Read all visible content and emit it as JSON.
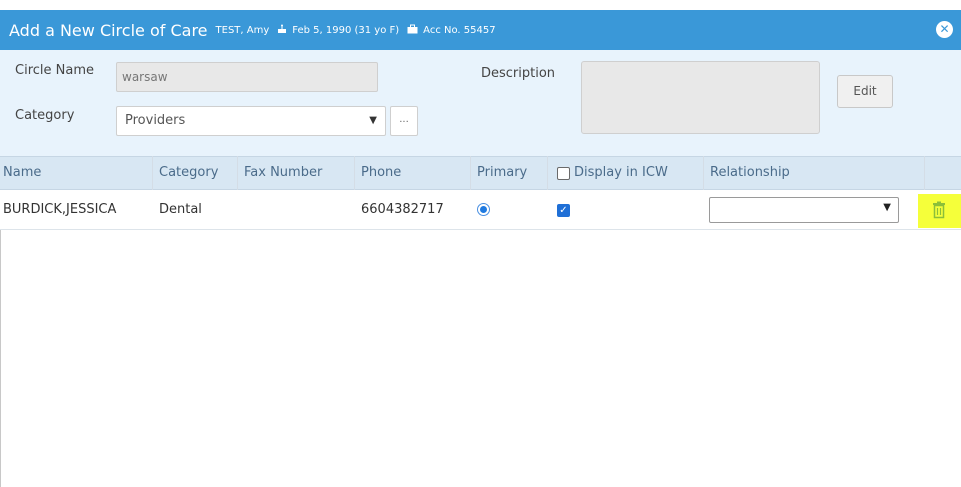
{
  "dialog": {
    "title": "Add a New Circle of Care",
    "patient_name": "TEST, Amy",
    "dob": "Feb 5, 1990 (31 yo F)",
    "account": "Acc No. 55457",
    "close_icon": "close-icon",
    "accent_color": "#3a98d8"
  },
  "form": {
    "circle_name_label": "Circle Name",
    "circle_name_value": "warsaw",
    "category_label": "Category",
    "category_value": "Providers",
    "more_button": "...",
    "description_label": "Description",
    "edit_button": "Edit"
  },
  "table": {
    "headers": {
      "name": "Name",
      "category": "Category",
      "fax": "Fax Number",
      "phone": "Phone",
      "primary": "Primary",
      "display_icw": "Display in ICW",
      "relationship": "Relationship"
    },
    "rows": [
      {
        "name": "BURDICK,JESSICA",
        "category": "Dental",
        "fax": "",
        "phone": "6604382717",
        "primary": true,
        "display_icw": true,
        "relationship": ""
      }
    ]
  }
}
